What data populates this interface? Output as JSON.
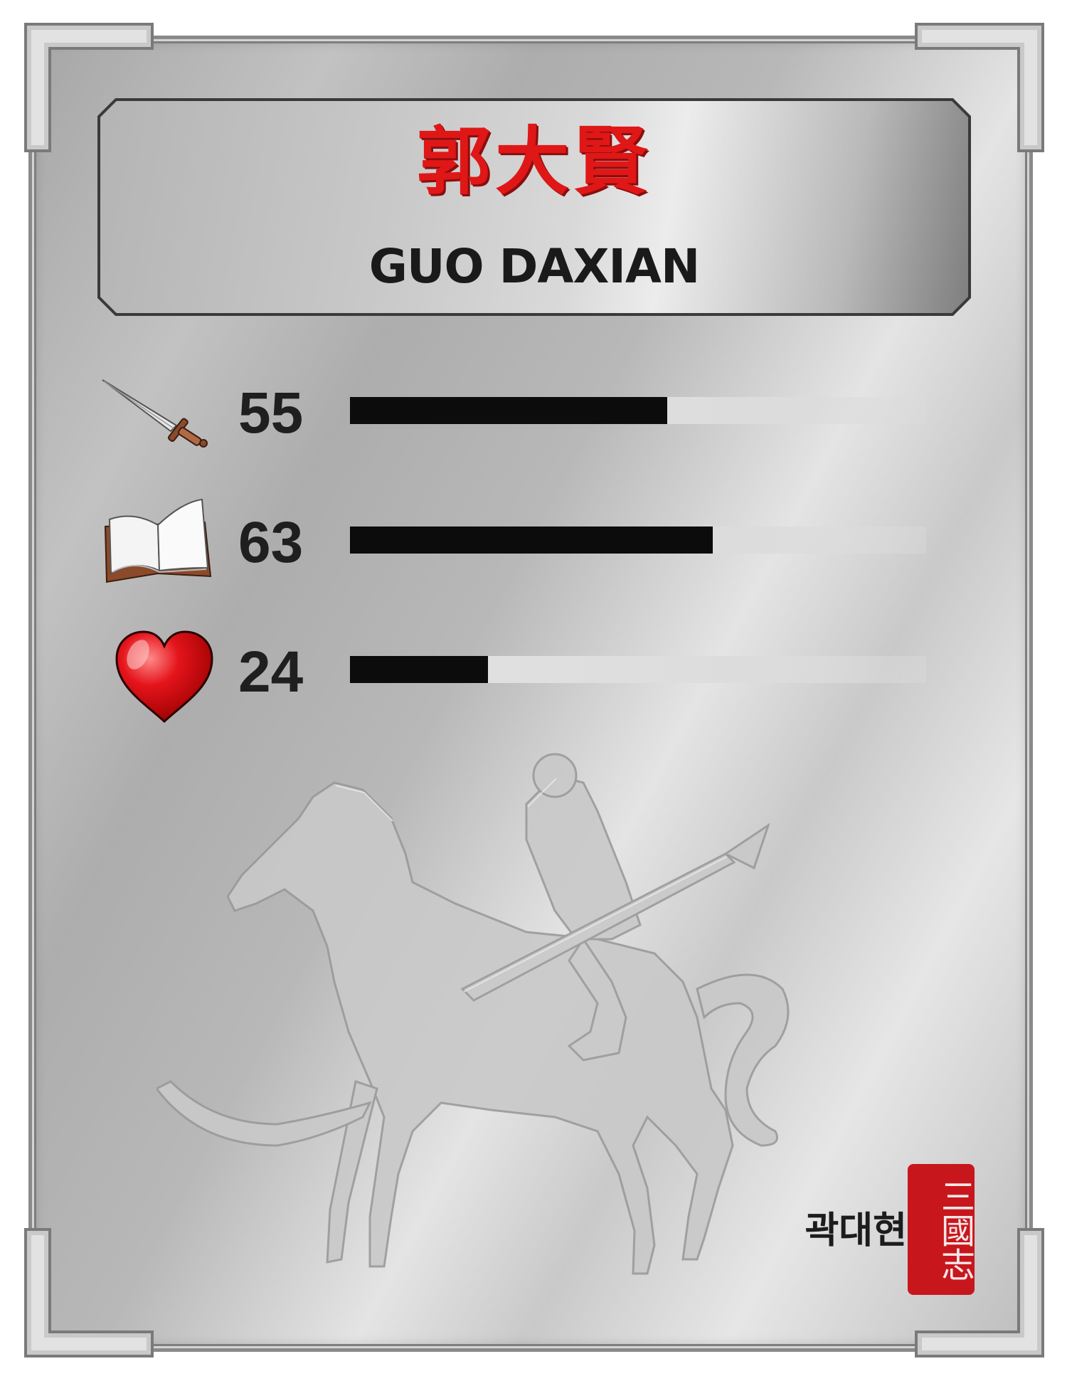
{
  "card": {
    "name_cn": "郭大賢",
    "name_en": "GUO DAXIAN",
    "name_ko": "곽대현",
    "seal_text": "三國志"
  },
  "stats": [
    {
      "icon": "sword-icon",
      "value": "55",
      "fraction": 0.55
    },
    {
      "icon": "book-icon",
      "value": "63",
      "fraction": 0.63
    },
    {
      "icon": "heart-icon",
      "value": "24",
      "fraction": 0.24
    }
  ],
  "colors": {
    "name_red": "#e01717",
    "bar_fill": "#0c0c0c",
    "bar_track": "#e0e0e0",
    "seal_red": "#c8161d",
    "heart_red": "#e4141b"
  }
}
